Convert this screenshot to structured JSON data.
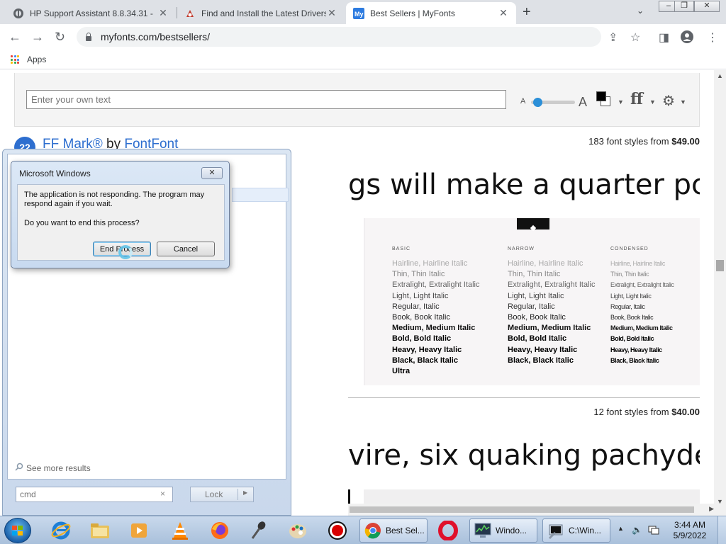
{
  "browser": {
    "tabs": [
      {
        "title": "HP Support Assistant 8.8.34.31 -",
        "icon": "hp-icon",
        "active": false
      },
      {
        "title": "Find and Install the Latest Drivers",
        "icon": "drivers-icon",
        "active": false
      },
      {
        "title": "Best Sellers | MyFonts",
        "icon": "myfonts-icon",
        "active": true
      }
    ],
    "url": "myfonts.com/bestsellers/",
    "bookmarks": {
      "apps_label": "Apps"
    }
  },
  "page": {
    "text_input_placeholder": "Enter your own text",
    "size_small_label": "A",
    "size_big_label": "A",
    "ff_label": "ff",
    "font1": {
      "rank": "22",
      "name": "FF Mark®",
      "by": "by",
      "foundry": "FontFont",
      "styles_text": "183 font styles from",
      "price": "$49.00",
      "sample": "gs will make a quarter pc",
      "specimen": {
        "columns": [
          {
            "heading": "BASIC",
            "rows": [
              "Hairline, Hairline Italic",
              "Thin, Thin Italic",
              "Extralight, Extralight Italic",
              "Light, Light Italic",
              "Regular, Italic",
              "Book, Book Italic",
              "Medium, Medium Italic",
              "Bold, Bold Italic",
              "Heavy, Heavy Italic",
              "Black, Black Italic",
              "Ultra"
            ]
          },
          {
            "heading": "NARROW",
            "rows": [
              "Hairline, Hairline Italic",
              "Thin, Thin Italic",
              "Extralight, Extralight Italic",
              "Light, Light Italic",
              "Regular, Italic",
              "Book, Book Italic",
              "Medium, Medium Italic",
              "Bold, Bold Italic",
              "Heavy, Heavy Italic",
              "Black, Black Italic"
            ]
          },
          {
            "heading": "CONDENSED",
            "rows": [
              "Hairline, Hairline Italic",
              "Thin, Thin Italic",
              "Extralight, Extralight Italic",
              "Light, Light Italic",
              "Regular, Italic",
              "Book, Book Italic",
              "Medium, Medium Italic",
              "Bold, Bold Italic",
              "Heavy, Heavy Italic",
              "Black, Black Italic"
            ]
          }
        ]
      }
    },
    "font2": {
      "styles_text": "12 font styles from",
      "price": "$40.00",
      "sample": "vire, six quaking pachyderm"
    }
  },
  "start_panel": {
    "see_more": "See more results",
    "search_value": "cmd",
    "clear_icon": "×",
    "lock_label": "Lock"
  },
  "dialog": {
    "title": "Microsoft Windows",
    "message": "The application is not responding. The program may respond again if you wait.",
    "question": "Do you want to end this process?",
    "end_button": "End Process",
    "cancel_button": "Cancel"
  },
  "taskbar": {
    "apps": [
      {
        "label": "Best Sel...",
        "icon": "chrome-icon"
      },
      {
        "label": "Windo...",
        "icon": "task-manager-icon"
      },
      {
        "label": "C:\\Win...",
        "icon": "cmd-icon"
      }
    ],
    "time": "3:44 AM",
    "date": "5/9/2022"
  },
  "colors": {
    "accent_blue": "#2d6ecf",
    "slider_blue": "#2b8fd8",
    "chrome_tab_bg": "#dee1e6"
  }
}
